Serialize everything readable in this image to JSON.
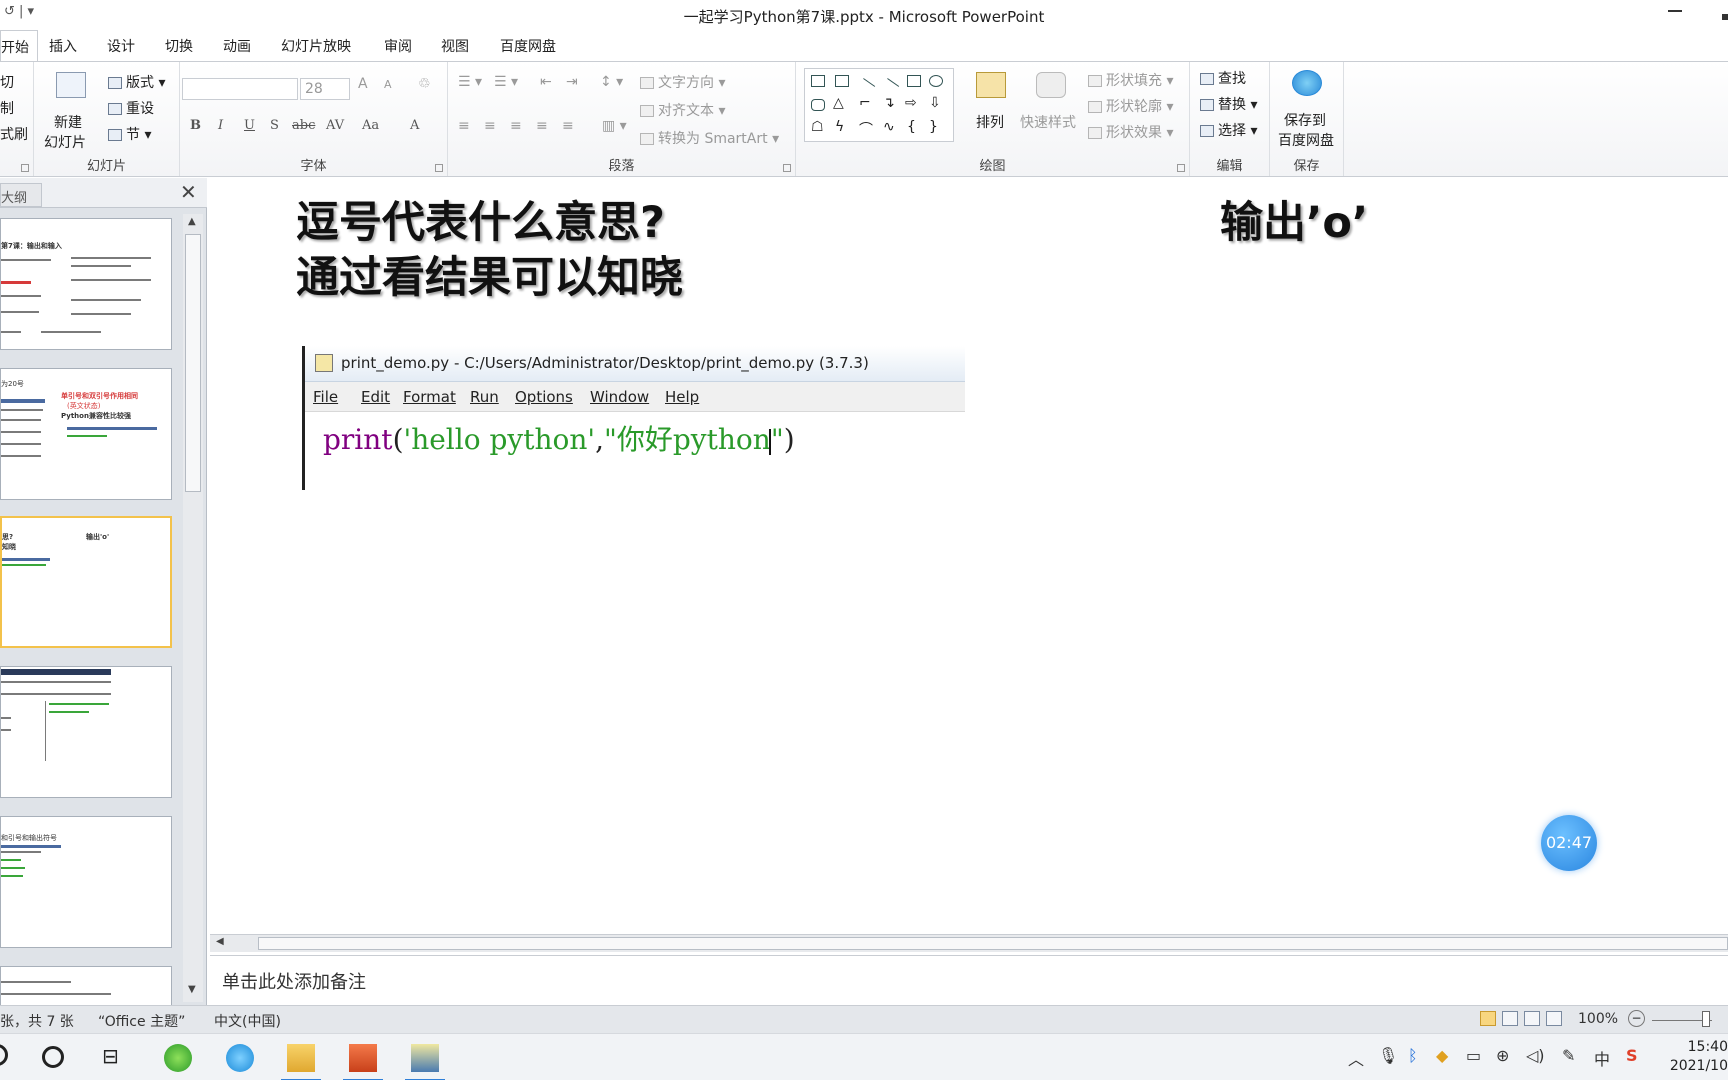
{
  "window": {
    "title": "一起学习Python第7课.pptx - Microsoft PowerPoint"
  },
  "tabs": [
    {
      "label": "开始",
      "active": true
    },
    {
      "label": "插入"
    },
    {
      "label": "设计"
    },
    {
      "label": "切换"
    },
    {
      "label": "动画"
    },
    {
      "label": "幻灯片放映"
    },
    {
      "label": "审阅"
    },
    {
      "label": "视图"
    },
    {
      "label": "百度网盘"
    }
  ],
  "ribbon": {
    "clipboard": {
      "cut": "切",
      "copy": "制",
      "painter": "式刷"
    },
    "slides": {
      "label": "幻灯片",
      "new_slide_line1": "新建",
      "new_slide_line2": "幻灯片",
      "layout": "版式",
      "reset": "重设",
      "section": "节"
    },
    "font": {
      "label": "字体",
      "size": "28",
      "bold": "B",
      "italic": "I",
      "underline": "U",
      "strike": "S",
      "abc": "abc",
      "spacing": "AV",
      "case": "Aa",
      "color": "A",
      "grow": "A",
      "shrink": "A"
    },
    "paragraph": {
      "label": "段落",
      "text_direction": "文字方向",
      "align_text": "对齐文本",
      "smartart": "转换为 SmartArt"
    },
    "drawing": {
      "label": "绘图",
      "arrange": "排列",
      "quick_styles": "快速样式",
      "shape_fill": "形状填充",
      "shape_outline": "形状轮廓",
      "shape_effects": "形状效果"
    },
    "editing": {
      "label": "编辑",
      "find": "查找",
      "replace": "替换",
      "select": "选择"
    },
    "save": {
      "label": "保存",
      "button_line1": "保存到",
      "button_line2": "百度网盘"
    }
  },
  "panel": {
    "outline_tab": "大纲",
    "thumbs": [
      {
        "title": "第7课：输出和输入"
      },
      {
        "title": "为20号",
        "note1": "单引号和双引号作用相同",
        "note2": "(英文状态)",
        "note3": "Python兼容性比较强"
      },
      {
        "title": "思?",
        "right": "输出'o'",
        "line2": "知晓"
      },
      {
        "title": ""
      },
      {
        "title": "和引号和输出符号"
      },
      {
        "title": ""
      }
    ]
  },
  "slide": {
    "heading_line1": "逗号代表什么意思?",
    "heading_line2": "通过看结果可以知晓",
    "right_heading": "输出’o’",
    "ide": {
      "title": "print_demo.py - C:/Users/Administrator/Desktop/print_demo.py (3.7.3)",
      "menu": [
        "File",
        "Edit",
        "Format",
        "Run",
        "Options",
        "Window",
        "Help"
      ],
      "code_kw": "print",
      "code_open": "(",
      "code_str1": "'hello python'",
      "code_comma": ",",
      "code_str2": "\"你好python",
      "code_str2_end": "\"",
      "code_close": ")"
    }
  },
  "notes": {
    "placeholder": "单击此处添加备注"
  },
  "timer": {
    "value": "02:47"
  },
  "status": {
    "slide_count": "张，共 7 张",
    "theme": "“Office 主题”",
    "language": "中文(中国)",
    "zoom": "100%"
  },
  "taskbar": {
    "ime": "中",
    "clock_time": "15:40",
    "clock_date": "2021/10"
  }
}
